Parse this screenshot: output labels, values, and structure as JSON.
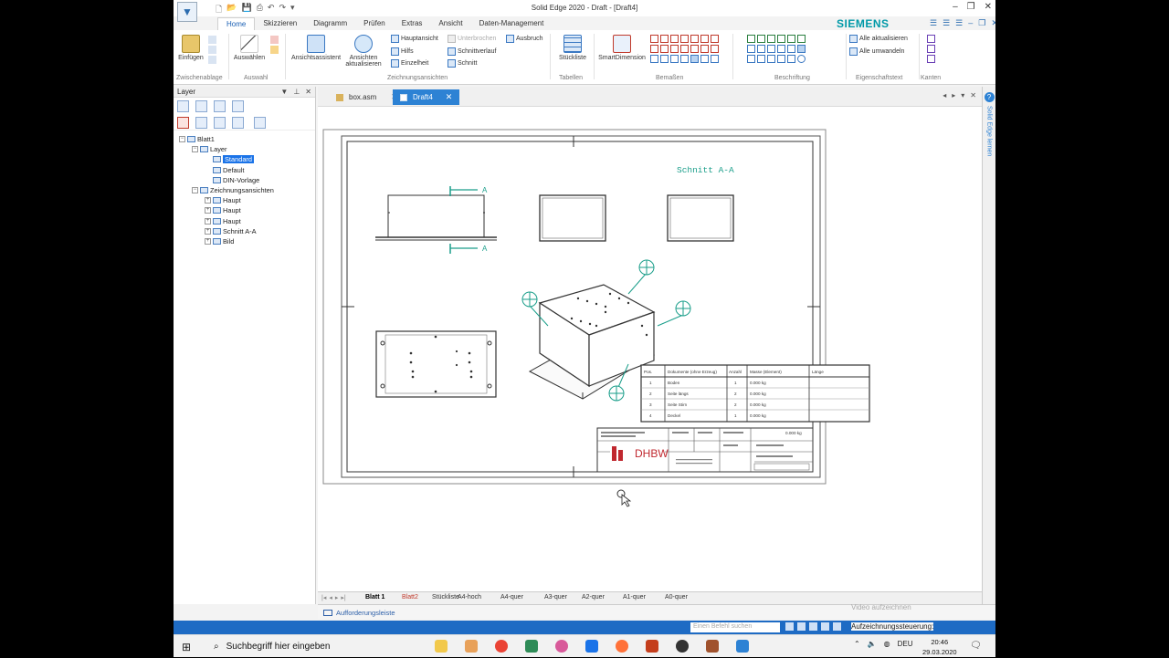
{
  "window": {
    "title": "Solid Edge 2020 - Draft - [Draft4]",
    "brand": "SIEMENS",
    "controls": [
      "–",
      "❐",
      "✕"
    ]
  },
  "ribbon": {
    "tabs": [
      "Home",
      "Skizzieren",
      "Diagramm",
      "Prüfen",
      "Extras",
      "Ansicht",
      "Daten-Management"
    ],
    "active_tab": "Home",
    "buttons": {
      "einfuegen": "Einfügen",
      "auswaehlen": "Auswählen",
      "ansichtsassistent": "Ansichtsassistent",
      "ansichten_aktualisieren_1": "Ansichten",
      "ansichten_aktualisieren_2": "aktualisieren",
      "stueckliste": "Stückliste",
      "smartdimension": "SmartDimension"
    },
    "small": {
      "hauptansicht": "Hauptansicht",
      "unterbrochen": "Unterbrochen",
      "ausbruch": "Ausbruch",
      "hilfs": "Hilfs",
      "schnittverlauf": "Schnittverlauf",
      "einzelheit": "Einzelheit",
      "schnitt": "Schnitt",
      "alle_aktualisieren": "Alle aktualisieren",
      "alle_umwandeln": "Alle umwandeln"
    },
    "groups": [
      "Zwischenablage",
      "Auswahl",
      "Zeichnungsansichten",
      "Tabellen",
      "Bemaßen",
      "Beschriftung",
      "Eigenschaftstext",
      "Kanten"
    ]
  },
  "left_panel": {
    "title": "Layer",
    "tree": [
      {
        "label": "Blatt1",
        "level": 0,
        "expander": "−"
      },
      {
        "label": "Layer",
        "level": 1,
        "expander": "−"
      },
      {
        "label": "Standard",
        "level": 2,
        "expander": "",
        "selected": true
      },
      {
        "label": "Default",
        "level": 2,
        "expander": ""
      },
      {
        "label": "DIN-Vorlage",
        "level": 2,
        "expander": ""
      },
      {
        "label": "Zeichnungsansichten",
        "level": 1,
        "expander": "−"
      },
      {
        "label": "Haupt",
        "level": 2,
        "expander": "+"
      },
      {
        "label": "Haupt",
        "level": 2,
        "expander": "+"
      },
      {
        "label": "Haupt",
        "level": 2,
        "expander": "+"
      },
      {
        "label": "Schnitt A-A",
        "level": 2,
        "expander": "+"
      },
      {
        "label": "Bild",
        "level": 2,
        "expander": "+"
      }
    ]
  },
  "doc_tabs": [
    {
      "label": "box.asm",
      "active": false
    },
    {
      "label": "Draft4",
      "active": true
    }
  ],
  "drawing": {
    "section_label": "Schnitt A-A",
    "section_marker": "A",
    "company_logo": "DHBW",
    "parts_list": {
      "headers": [
        "Pos.",
        "Dokumente (ohne Erzeug)",
        "Anzahl",
        "Masse (Element)",
        "Länge"
      ],
      "rows": [
        [
          "1",
          "Boden",
          "1",
          "0.000 kg",
          ""
        ],
        [
          "2",
          "Seite längs",
          "2",
          "0.000 kg",
          ""
        ],
        [
          "3",
          "Seite Stirn",
          "2",
          "0.000 kg",
          ""
        ],
        [
          "4",
          "Deckel",
          "1",
          "0.000 kg",
          ""
        ]
      ]
    },
    "title_block_weight": "0.000 kg"
  },
  "sheet_tabs": [
    {
      "label": "Blatt 1",
      "active": true
    },
    {
      "label": "Blatt2",
      "red": true
    },
    {
      "label": "Stückliste"
    },
    {
      "label": "A4-hoch"
    },
    {
      "label": "A4-quer"
    },
    {
      "label": "A3-quer"
    },
    {
      "label": "A2-quer"
    },
    {
      "label": "A1-quer"
    },
    {
      "label": "A0-quer"
    }
  ],
  "right_dock": {
    "help": "?",
    "label": "Solid Edge lernen"
  },
  "prompt_bar": {
    "label": "Aufforderungsleiste"
  },
  "status": {
    "command_placeholder": "Einen Befehl suchen"
  },
  "recorder": {
    "line1": "Video aufzeichnen",
    "line2": "Aufzeichnungssteuerung:"
  },
  "taskbar": {
    "search_placeholder": "Suchbegriff hier eingeben",
    "language": "DEU",
    "time": "20:46",
    "date": "29.03.2020"
  },
  "colors": {
    "accent": "#2d82d4",
    "brand": "#0099a8",
    "annotation": "#1a9e8a",
    "status_bar": "#1e6bc4"
  }
}
